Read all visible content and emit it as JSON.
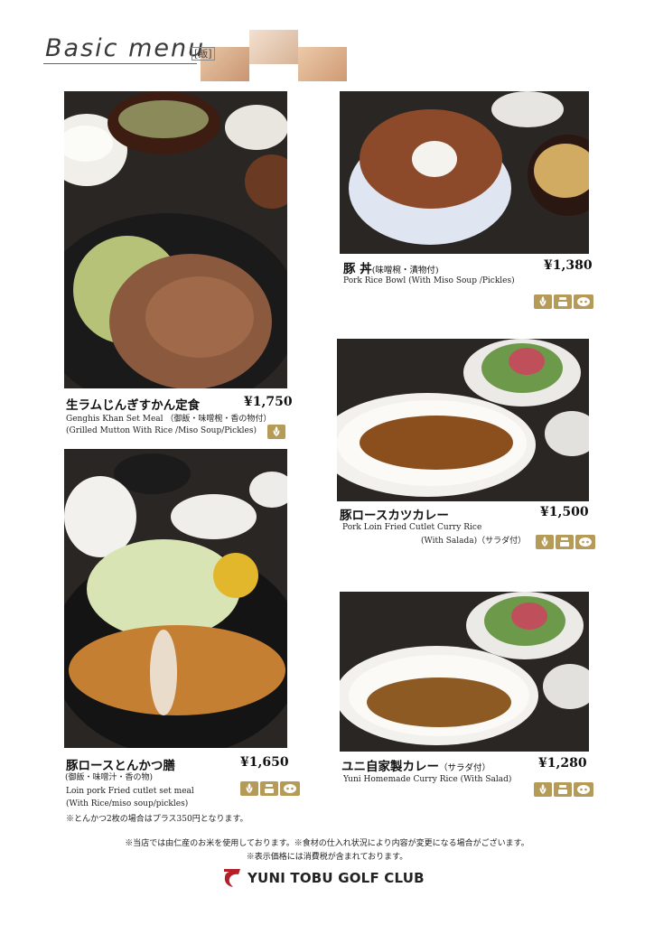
{
  "header": {
    "title": "Basic menu",
    "subtitle": "[飯]"
  },
  "items": [
    {
      "name_jp": "生ラムじんぎすかん定食",
      "price": "¥1,750",
      "en1": "Genghis Khan Set Meal （御飯・味噌椀・香の物付）",
      "en2": "(Grilled Mutton With Rice /Miso Soup/Pickles)",
      "badges": [
        "rice-icon"
      ]
    },
    {
      "name_jp": "豚 丼",
      "name_jp_sub": "(味噌椀・漬物付)",
      "price": "¥1,380",
      "en1": "Pork Rice Bowl (With Miso Soup /Pickles)",
      "badges": [
        "rice-icon",
        "bowl-icon",
        "pig-icon"
      ]
    },
    {
      "name_jp": "豚ロースカツカレー",
      "price": "¥1,500",
      "en1": "Pork Loin Fried Cutlet Curry Rice",
      "en2": "(With Salada)（サラダ付）",
      "badges": [
        "rice-icon",
        "bowl-icon",
        "pig-icon"
      ]
    },
    {
      "name_jp": "豚ロースとんかつ膳",
      "price": "¥1,650",
      "en0": "(御飯・味噌汁・香の物)",
      "en1": "Loin pork Fried cutlet set meal",
      "en2": "(With Rice/miso soup/pickles)",
      "note": "※とんかつ2枚の場合はプラス350円となります。",
      "badges": [
        "rice-icon",
        "bowl-icon",
        "pig-icon"
      ]
    },
    {
      "name_jp": "ユニ自家製カレー",
      "name_jp_sub": "（サラダ付）",
      "price": "¥1,280",
      "en1": "Yuni Homemade Curry Rice (With Salad)",
      "badges": [
        "rice-icon",
        "bowl-icon",
        "pig-icon"
      ]
    }
  ],
  "footer": {
    "line1": "※当店では由仁産のお米を使用しております。※食材の仕入れ状況により内容が変更になる場合がございます。",
    "line2": "※表示価格には消費税が含まれております。"
  },
  "logo": {
    "text": "YUNI TOBU GOLF CLUB"
  },
  "colors": {
    "badge": "#b59a58",
    "accent": "#c8996f",
    "logo_red": "#b3202a"
  }
}
